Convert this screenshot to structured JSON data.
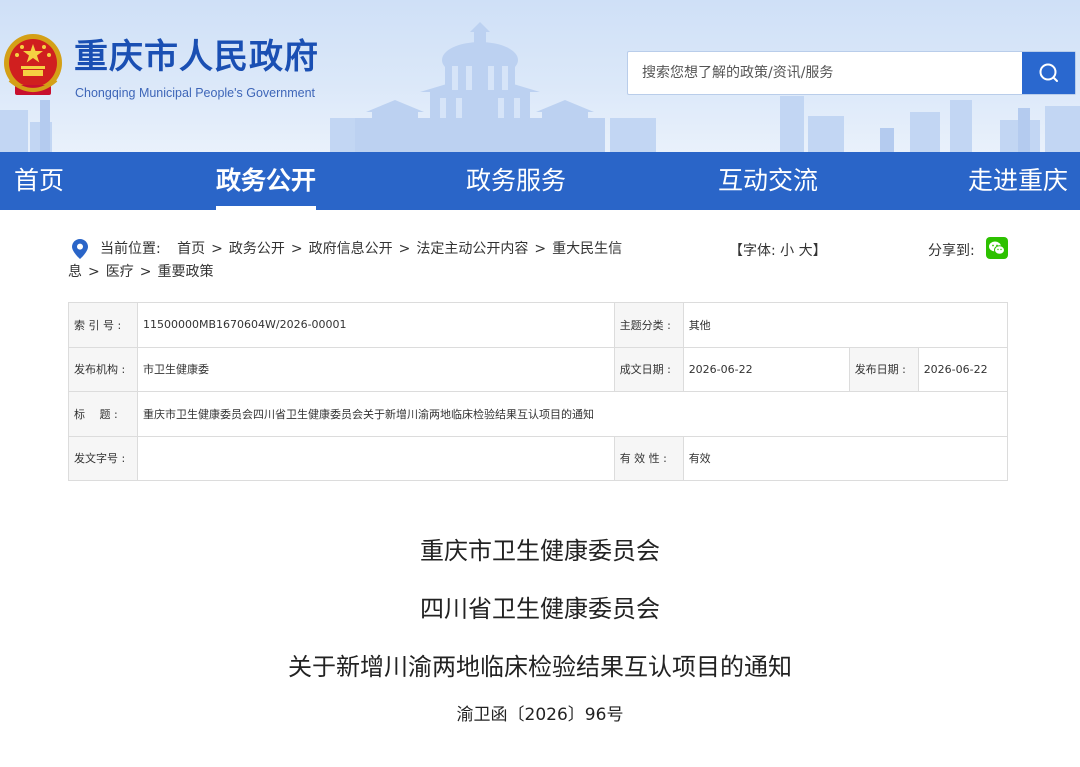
{
  "header": {
    "title": "重庆市人民政府",
    "subtitle": "Chongqing Municipal People's Government",
    "search_placeholder": "搜索您想了解的政策/资讯/服务",
    "brand_color": "#2a65c8"
  },
  "nav": {
    "items": [
      {
        "label": "首页"
      },
      {
        "label": "政务公开",
        "active": true
      },
      {
        "label": "政务服务"
      },
      {
        "label": "互动交流"
      },
      {
        "label": "走进重庆"
      }
    ]
  },
  "breadcrumb": {
    "prefix": "当前位置:",
    "items": [
      "首页",
      "政务公开",
      "政府信息公开",
      "法定主动公开内容",
      "重大民生信息",
      "医疗",
      "重要政策"
    ]
  },
  "font_size": {
    "open": "【字体:",
    "small": "小",
    "large": "大",
    "close": "】"
  },
  "share": {
    "label": "分享到:",
    "icon": "wechat-icon"
  },
  "info": {
    "index_label": "索 引 号 :",
    "index_value": "11500000MB1670604W/2026-00001",
    "category_label": "主题分类 :",
    "category_value": "其他",
    "publisher_label": "发布机构 :",
    "publisher_value": "市卫生健康委",
    "written_date_label": "成文日期 :",
    "written_date_value": "2026-06-22",
    "publish_date_label": "发布日期 :",
    "publish_date_value": "2026-06-22",
    "title_label": "标　 题 :",
    "title_value": "重庆市卫生健康委员会四川省卫生健康委员会关于新增川渝两地临床检验结果互认项目的通知",
    "doc_number_label": "发文字号 :",
    "doc_number_value": "",
    "validity_label": "有 效 性 :",
    "validity_value": "有效"
  },
  "document": {
    "line1": "重庆市卫生健康委员会",
    "line2": "四川省卫生健康委员会",
    "line3": "关于新增川渝两地临床检验结果互认项目的通知",
    "number": "渝卫函〔2026〕96号"
  }
}
